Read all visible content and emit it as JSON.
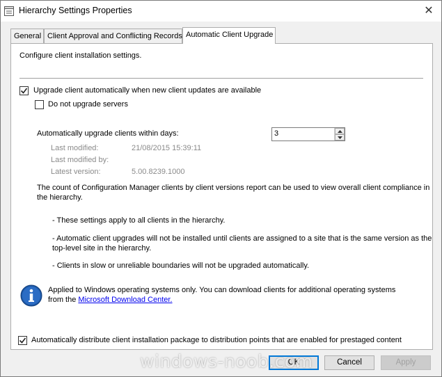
{
  "window": {
    "title": "Hierarchy Settings Properties",
    "close_glyph": "✕"
  },
  "tabs": [
    {
      "label": "General"
    },
    {
      "label": "Client Approval and Conflicting Records"
    },
    {
      "label": "Automatic Client Upgrade"
    }
  ],
  "panel": {
    "intro": "Configure client installation settings.",
    "upgrade_auto": {
      "label": "Upgrade client automatically when new client updates are available",
      "checked": true
    },
    "no_servers": {
      "label": "Do not upgrade servers",
      "checked": false
    },
    "days_label": "Automatically upgrade clients within days:",
    "days_value": "3",
    "last_modified_label": "Last modified:",
    "last_modified_value": "21/08/2015 15:39:11",
    "last_modified_by_label": "Last modified by:",
    "latest_version_label": "Latest version:",
    "latest_version_value": "5.00.8239.1000",
    "report_line1": "The count of Configuration Manager clients by client versions report can be used to view overall client compliance in",
    "report_line2": "the hierarchy.",
    "note1": "- These settings apply to all clients in the hierarchy.",
    "note2_line1": "- Automatic client upgrades will not be installed until clients are assigned to a site that is the same version as the",
    "note2_line2": "top-level site in the hierarchy.",
    "note3": "- Clients in slow or unreliable boundaries will not be upgraded automatically.",
    "info_line1": "Applied to Windows operating systems only. You can download clients for additional operating systems",
    "info_line2_prefix": "from the ",
    "info_link": "Microsoft Download Center.",
    "distribute": {
      "label": "Automatically distribute client installation package to distribution points that are enabled for prestaged content",
      "checked": true
    }
  },
  "buttons": {
    "ok": "OK",
    "cancel": "Cancel",
    "apply": "Apply"
  },
  "watermark": "windows-noob.com",
  "colors": {
    "link": "#0000ee",
    "default_button_border": "#0078d7",
    "info_icon": "#1e5aa8"
  }
}
